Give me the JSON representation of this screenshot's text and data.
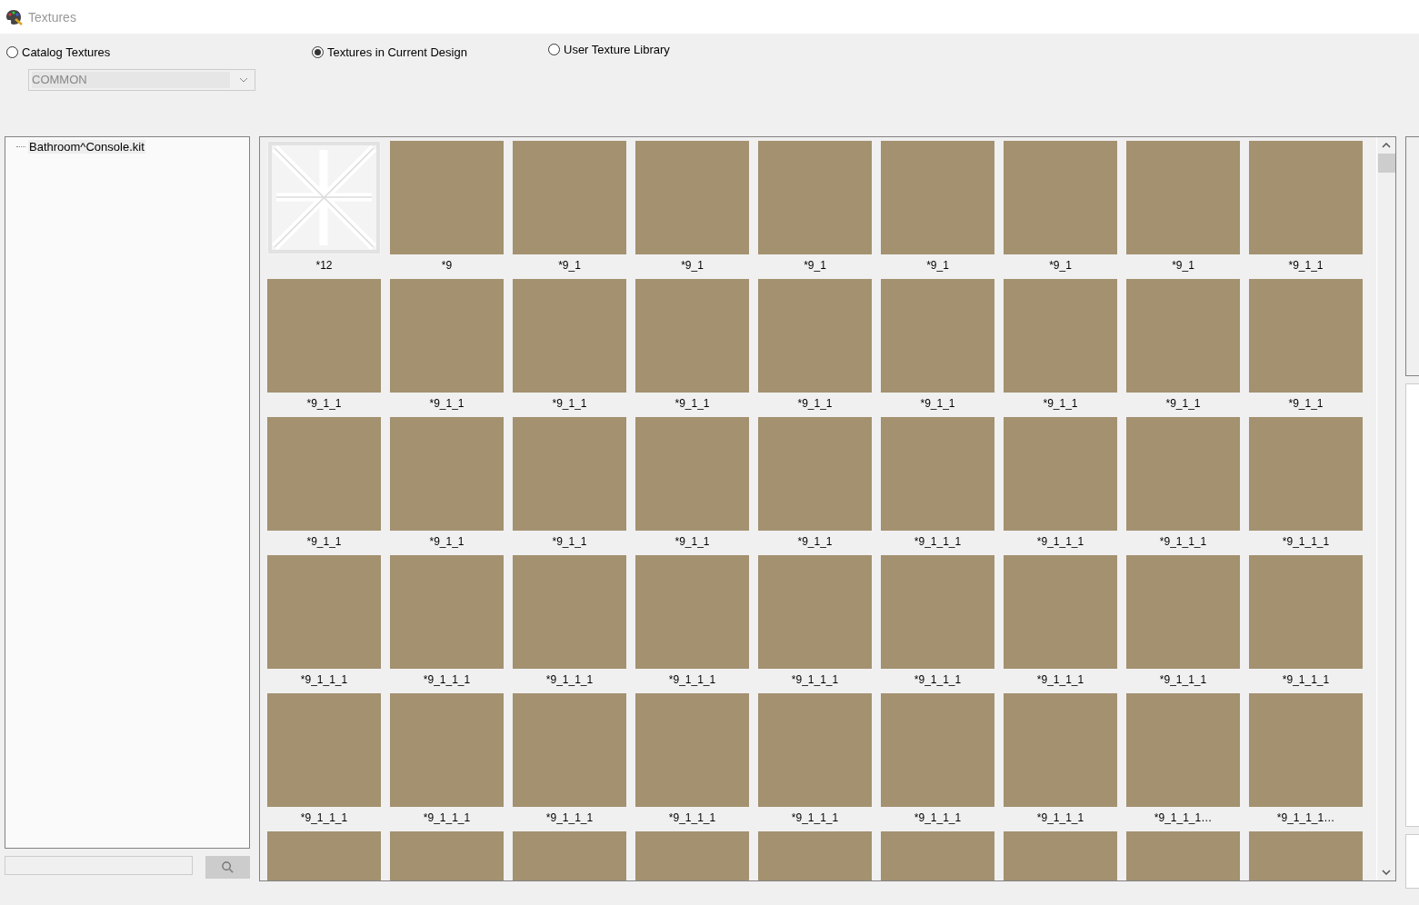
{
  "window": {
    "title": "Textures"
  },
  "sources": [
    {
      "label": "Catalog Textures",
      "selected": false
    },
    {
      "label": "Textures in Current Design",
      "selected": true
    },
    {
      "label": "User Texture Library",
      "selected": false
    }
  ],
  "catalog_dropdown": {
    "value": "COMMON",
    "disabled": true
  },
  "tree": {
    "items": [
      {
        "label": "Bathroom^Console.kit"
      }
    ]
  },
  "tiles": [
    {
      "kind": "pattern",
      "label": "*12"
    },
    {
      "kind": "swatch",
      "color": "#a39170",
      "label": "*9"
    },
    {
      "kind": "swatch",
      "color": "#a39170",
      "label": "*9_1"
    },
    {
      "kind": "swatch",
      "color": "#a39170",
      "label": "*9_1"
    },
    {
      "kind": "swatch",
      "color": "#a39170",
      "label": "*9_1"
    },
    {
      "kind": "swatch",
      "color": "#a39170",
      "label": "*9_1"
    },
    {
      "kind": "swatch",
      "color": "#a39170",
      "label": "*9_1"
    },
    {
      "kind": "swatch",
      "color": "#a39170",
      "label": "*9_1"
    },
    {
      "kind": "swatch",
      "color": "#a39170",
      "label": "*9_1_1"
    },
    {
      "kind": "swatch",
      "color": "#a39170",
      "label": "*9_1_1"
    },
    {
      "kind": "swatch",
      "color": "#a39170",
      "label": "*9_1_1"
    },
    {
      "kind": "swatch",
      "color": "#a39170",
      "label": "*9_1_1"
    },
    {
      "kind": "swatch",
      "color": "#a39170",
      "label": "*9_1_1"
    },
    {
      "kind": "swatch",
      "color": "#a39170",
      "label": "*9_1_1"
    },
    {
      "kind": "swatch",
      "color": "#a39170",
      "label": "*9_1_1"
    },
    {
      "kind": "swatch",
      "color": "#a39170",
      "label": "*9_1_1"
    },
    {
      "kind": "swatch",
      "color": "#a39170",
      "label": "*9_1_1"
    },
    {
      "kind": "swatch",
      "color": "#a39170",
      "label": "*9_1_1"
    },
    {
      "kind": "swatch",
      "color": "#a39170",
      "label": "*9_1_1"
    },
    {
      "kind": "swatch",
      "color": "#a39170",
      "label": "*9_1_1"
    },
    {
      "kind": "swatch",
      "color": "#a39170",
      "label": "*9_1_1"
    },
    {
      "kind": "swatch",
      "color": "#a39170",
      "label": "*9_1_1"
    },
    {
      "kind": "swatch",
      "color": "#a39170",
      "label": "*9_1_1"
    },
    {
      "kind": "swatch",
      "color": "#a39170",
      "label": "*9_1_1_1"
    },
    {
      "kind": "swatch",
      "color": "#a39170",
      "label": "*9_1_1_1"
    },
    {
      "kind": "swatch",
      "color": "#a39170",
      "label": "*9_1_1_1"
    },
    {
      "kind": "swatch",
      "color": "#a39170",
      "label": "*9_1_1_1"
    },
    {
      "kind": "swatch",
      "color": "#a39170",
      "label": "*9_1_1_1"
    },
    {
      "kind": "swatch",
      "color": "#a39170",
      "label": "*9_1_1_1"
    },
    {
      "kind": "swatch",
      "color": "#a39170",
      "label": "*9_1_1_1"
    },
    {
      "kind": "swatch",
      "color": "#a39170",
      "label": "*9_1_1_1"
    },
    {
      "kind": "swatch",
      "color": "#a39170",
      "label": "*9_1_1_1"
    },
    {
      "kind": "swatch",
      "color": "#a39170",
      "label": "*9_1_1_1"
    },
    {
      "kind": "swatch",
      "color": "#a39170",
      "label": "*9_1_1_1"
    },
    {
      "kind": "swatch",
      "color": "#a39170",
      "label": "*9_1_1_1"
    },
    {
      "kind": "swatch",
      "color": "#a39170",
      "label": "*9_1_1_1"
    },
    {
      "kind": "swatch",
      "color": "#a39170",
      "label": "*9_1_1_1"
    },
    {
      "kind": "swatch",
      "color": "#a39170",
      "label": "*9_1_1_1"
    },
    {
      "kind": "swatch",
      "color": "#a39170",
      "label": "*9_1_1_1"
    },
    {
      "kind": "swatch",
      "color": "#a39170",
      "label": "*9_1_1_1"
    },
    {
      "kind": "swatch",
      "color": "#a39170",
      "label": "*9_1_1_1"
    },
    {
      "kind": "swatch",
      "color": "#a39170",
      "label": "*9_1_1_1"
    },
    {
      "kind": "swatch",
      "color": "#a39170",
      "label": "*9_1_1_1"
    },
    {
      "kind": "swatch",
      "color": "#a39170",
      "label": "*9_1_1_1…"
    },
    {
      "kind": "swatch",
      "color": "#a39170",
      "label": "*9_1_1_1…"
    },
    {
      "kind": "swatch",
      "color": "#a39170"
    },
    {
      "kind": "swatch",
      "color": "#a39170"
    },
    {
      "kind": "swatch",
      "color": "#a39170"
    },
    {
      "kind": "swatch",
      "color": "#a39170"
    },
    {
      "kind": "swatch",
      "color": "#a39170"
    },
    {
      "kind": "swatch",
      "color": "#a39170"
    },
    {
      "kind": "swatch",
      "color": "#a39170"
    },
    {
      "kind": "swatch",
      "color": "#a39170"
    },
    {
      "kind": "swatch",
      "color": "#a39170"
    }
  ]
}
